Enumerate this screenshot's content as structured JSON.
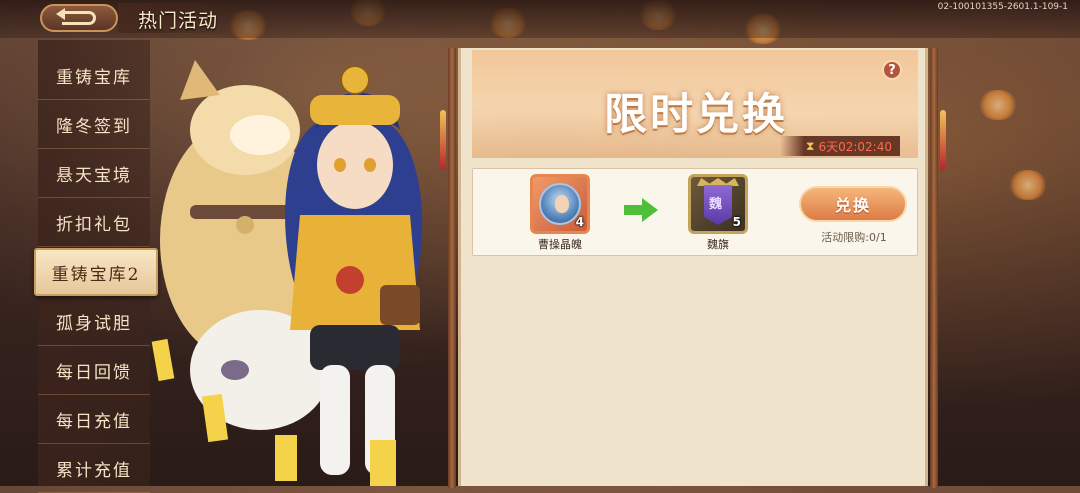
{
  "header": {
    "title": "热门活动",
    "back_icon": "back-arrow-icon",
    "version": "02-100101355-2601.1-109-1"
  },
  "sidebar": {
    "items": [
      {
        "label": "重铸宝库"
      },
      {
        "label": "隆冬签到"
      },
      {
        "label": "悬天宝境"
      },
      {
        "label": "折扣礼包"
      },
      {
        "label": "重铸宝库2",
        "active": true
      },
      {
        "label": "孤身试胆"
      },
      {
        "label": "每日回馈"
      },
      {
        "label": "每日充值"
      },
      {
        "label": "累计充值"
      }
    ]
  },
  "banner": {
    "title": "限时兑换",
    "help_icon": "question-icon",
    "help_label": "?",
    "timer_icon": "hourglass-icon",
    "countdown": "6天02:02:40"
  },
  "exchange": {
    "cost_item": {
      "name": "曹操晶魄",
      "count": "4"
    },
    "reward_item": {
      "name": "魏旗",
      "count": "5",
      "flag_char": "魏"
    },
    "arrow_icon": "arrow-right-icon",
    "button_label": "兑换",
    "limit_text": "活动限购:0/1"
  },
  "colors": {
    "accent": "#dd7c45",
    "timer": "#ff6a4a",
    "panel": "#efe3cc"
  }
}
